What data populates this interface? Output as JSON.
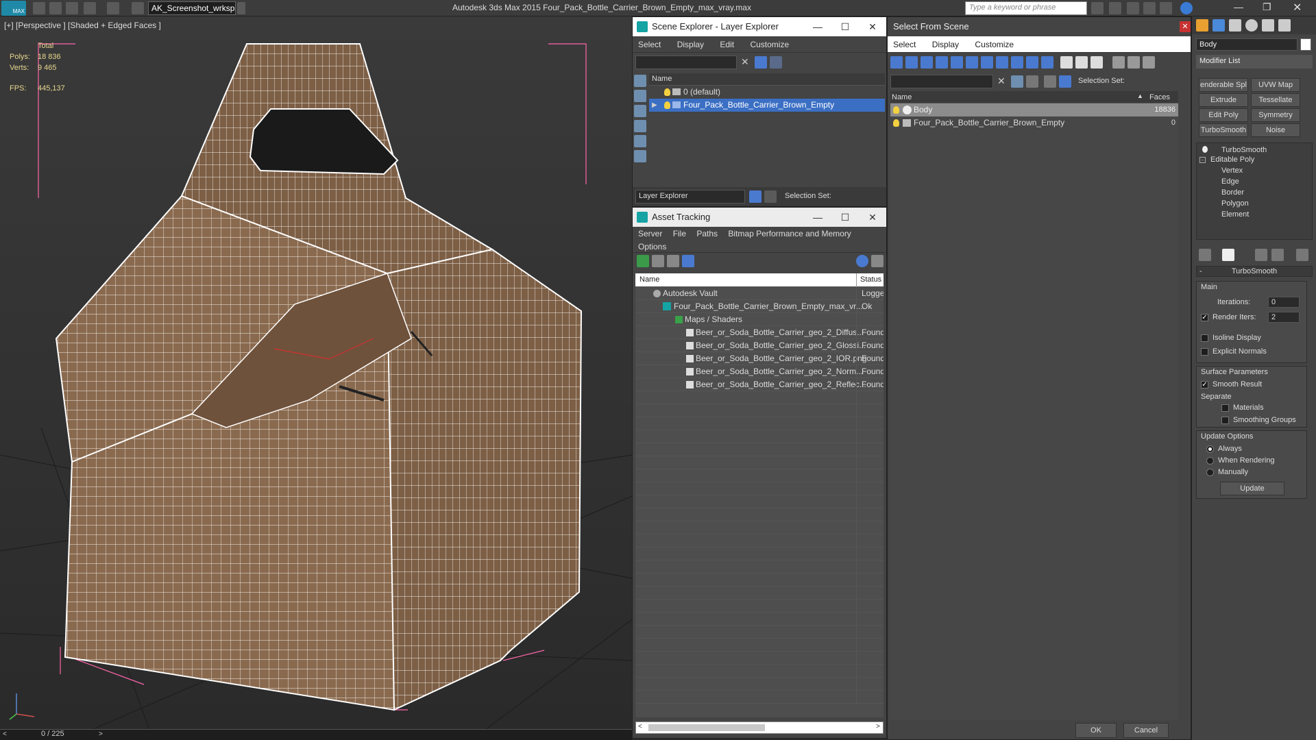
{
  "titlebar": {
    "app_badge": "MAX",
    "workspace": "AK_Screenshot_wrksp",
    "title": "Autodesk 3ds Max  2015     Four_Pack_Bottle_Carrier_Brown_Empty_max_vray.max",
    "search_placeholder": "Type a keyword or phrase"
  },
  "viewport": {
    "label": "[+] [Perspective ] [Shaded + Edged Faces ]",
    "stats_total": "Total",
    "polys_label": "Polys:",
    "polys_value": "18 836",
    "verts_label": "Verts:",
    "verts_value": "9 465",
    "fps_label": "FPS:",
    "fps_value": "445,137",
    "frame": "0 / 225",
    "colors": {
      "model": "#8a6a4f",
      "wire": "#ffffff",
      "bbox": "#ff66aa"
    }
  },
  "scene_explorer": {
    "title": "Scene Explorer - Layer Explorer",
    "menu": [
      "Select",
      "Display",
      "Edit",
      "Customize"
    ],
    "col_name": "Name",
    "layers": [
      "0 (default)",
      "Four_Pack_Bottle_Carrier_Brown_Empty"
    ],
    "footer_select": "Layer Explorer",
    "selection_set": "Selection Set:"
  },
  "asset_tracking": {
    "title": "Asset Tracking",
    "menu": [
      "Server",
      "File",
      "Paths",
      "Bitmap Performance and Memory",
      "Options"
    ],
    "col_name": "Name",
    "col_status": "Status",
    "rows": [
      {
        "name": "Autodesk Vault",
        "status": "Logged"
      },
      {
        "name": "Four_Pack_Bottle_Carrier_Brown_Empty_max_vr...",
        "status": "Ok"
      },
      {
        "name": "Maps / Shaders",
        "status": ""
      },
      {
        "name": "Beer_or_Soda_Bottle_Carrier_geo_2_Diffus...",
        "status": "Found"
      },
      {
        "name": "Beer_or_Soda_Bottle_Carrier_geo_2_Glossi...",
        "status": "Found"
      },
      {
        "name": "Beer_or_Soda_Bottle_Carrier_geo_2_IOR.png",
        "status": "Found"
      },
      {
        "name": "Beer_or_Soda_Bottle_Carrier_geo_2_Norm...",
        "status": "Found"
      },
      {
        "name": "Beer_or_Soda_Bottle_Carrier_geo_2_Reflec...",
        "status": "Found"
      }
    ]
  },
  "select_from_scene": {
    "title": "Select From Scene",
    "menu": [
      "Select",
      "Display",
      "Customize"
    ],
    "selection_set": "Selection Set:",
    "col_name": "Name",
    "col_faces": "Faces",
    "rows": [
      {
        "name": "Body",
        "faces": "18836"
      },
      {
        "name": "Four_Pack_Bottle_Carrier_Brown_Empty",
        "faces": "0"
      }
    ],
    "ok": "OK",
    "cancel": "Cancel"
  },
  "command_panel": {
    "object_name": "Body",
    "modifier_list": "Modifier List",
    "buttons": [
      "enderable Spl",
      "UVW Map",
      "Extrude",
      "Tessellate",
      "Edit Poly",
      "Symmetry",
      "TurboSmooth",
      "Noise"
    ],
    "stack": [
      "TurboSmooth",
      "Editable Poly",
      "Vertex",
      "Edge",
      "Border",
      "Polygon",
      "Element"
    ],
    "turbosmooth": {
      "title": "TurboSmooth",
      "main": "Main",
      "iterations_label": "Iterations:",
      "iterations": "0",
      "render_iters_label": "Render Iters:",
      "render_iters": "2",
      "isoline": "Isoline Display",
      "explicit_normals": "Explicit Normals",
      "surface_params": "Surface Parameters",
      "smooth_result": "Smooth Result",
      "separate": "Separate",
      "materials": "Materials",
      "smoothing_groups": "Smoothing Groups",
      "update_options": "Update Options",
      "always": "Always",
      "when_rendering": "When Rendering",
      "manually": "Manually",
      "update": "Update"
    }
  }
}
